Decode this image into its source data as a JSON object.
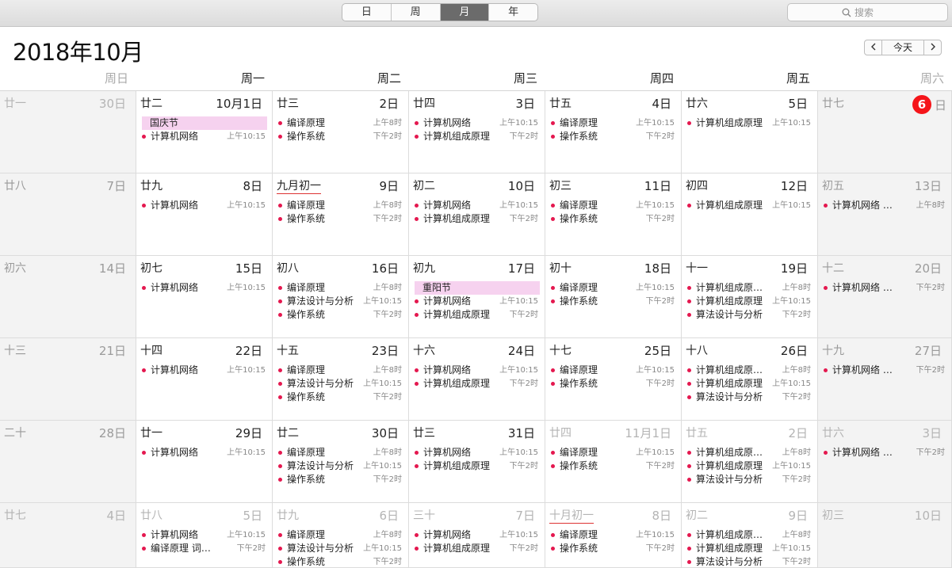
{
  "toolbar": {
    "views": [
      {
        "label": "日"
      },
      {
        "label": "周"
      },
      {
        "label": "月",
        "active": true
      },
      {
        "label": "年"
      }
    ],
    "search_placeholder": "搜索"
  },
  "header": {
    "title": "2018年10月",
    "today_label": "今天"
  },
  "weekdays": [
    "周日",
    "周一",
    "周二",
    "周三",
    "周四",
    "周五",
    "周六"
  ],
  "weeks": [
    [
      {
        "lunar": "廿一",
        "day": "30日",
        "outside": true
      },
      {
        "lunar": "廿二",
        "day": "10月1日",
        "allday": "国庆节",
        "events": [
          {
            "name": "计算机网络",
            "time": "上午10:15"
          }
        ]
      },
      {
        "lunar": "廿三",
        "day": "2日",
        "events": [
          {
            "name": "编译原理",
            "time": "上午8时"
          },
          {
            "name": "操作系统",
            "time": "下午2时"
          }
        ]
      },
      {
        "lunar": "廿四",
        "day": "3日",
        "events": [
          {
            "name": "计算机网络",
            "time": "上午10:15"
          },
          {
            "name": "计算机组成原理",
            "time": "下午2时"
          }
        ]
      },
      {
        "lunar": "廿五",
        "day": "4日",
        "events": [
          {
            "name": "编译原理",
            "time": "上午10:15"
          },
          {
            "name": "操作系统",
            "time": "下午2时"
          }
        ]
      },
      {
        "lunar": "廿六",
        "day": "5日",
        "events": [
          {
            "name": "计算机组成原理",
            "time": "上午10:15"
          }
        ]
      },
      {
        "lunar": "廿七",
        "day": "6",
        "daysuffix": "日",
        "today": true
      }
    ],
    [
      {
        "lunar": "廿八",
        "day": "7日"
      },
      {
        "lunar": "廿九",
        "day": "8日",
        "events": [
          {
            "name": "计算机网络",
            "time": "上午10:15"
          }
        ]
      },
      {
        "lunar": "九月初一",
        "day": "9日",
        "month": true,
        "events": [
          {
            "name": "编译原理",
            "time": "上午8时"
          },
          {
            "name": "操作系统",
            "time": "下午2时"
          }
        ]
      },
      {
        "lunar": "初二",
        "day": "10日",
        "events": [
          {
            "name": "计算机网络",
            "time": "上午10:15"
          },
          {
            "name": "计算机组成原理",
            "time": "下午2时"
          }
        ]
      },
      {
        "lunar": "初三",
        "day": "11日",
        "events": [
          {
            "name": "编译原理",
            "time": "上午10:15"
          },
          {
            "name": "操作系统",
            "time": "下午2时"
          }
        ]
      },
      {
        "lunar": "初四",
        "day": "12日",
        "events": [
          {
            "name": "计算机组成原理",
            "time": "上午10:15"
          }
        ]
      },
      {
        "lunar": "初五",
        "day": "13日",
        "events": [
          {
            "name": "计算机网络 计…",
            "time": "上午8时"
          }
        ]
      }
    ],
    [
      {
        "lunar": "初六",
        "day": "14日"
      },
      {
        "lunar": "初七",
        "day": "15日",
        "events": [
          {
            "name": "计算机网络",
            "time": "上午10:15"
          }
        ]
      },
      {
        "lunar": "初八",
        "day": "16日",
        "events": [
          {
            "name": "编译原理",
            "time": "上午8时"
          },
          {
            "name": "算法设计与分析",
            "time": "上午10:15"
          },
          {
            "name": "操作系统",
            "time": "下午2时"
          }
        ]
      },
      {
        "lunar": "初九",
        "day": "17日",
        "allday": "重阳节",
        "events": [
          {
            "name": "计算机网络",
            "time": "上午10:15"
          },
          {
            "name": "计算机组成原理",
            "time": "下午2时"
          }
        ]
      },
      {
        "lunar": "初十",
        "day": "18日",
        "events": [
          {
            "name": "编译原理",
            "time": "上午10:15"
          },
          {
            "name": "操作系统",
            "time": "下午2时"
          }
        ]
      },
      {
        "lunar": "十一",
        "day": "19日",
        "events": [
          {
            "name": "计算机组成原理…",
            "time": "上午8时"
          },
          {
            "name": "计算机组成原理",
            "time": "上午10:15"
          },
          {
            "name": "算法设计与分析",
            "time": "下午2时"
          }
        ]
      },
      {
        "lunar": "十二",
        "day": "20日",
        "events": [
          {
            "name": "计算机网络 交…",
            "time": "下午2时"
          }
        ]
      }
    ],
    [
      {
        "lunar": "十三",
        "day": "21日"
      },
      {
        "lunar": "十四",
        "day": "22日",
        "events": [
          {
            "name": "计算机网络",
            "time": "上午10:15"
          }
        ]
      },
      {
        "lunar": "十五",
        "day": "23日",
        "events": [
          {
            "name": "编译原理",
            "time": "上午8时"
          },
          {
            "name": "算法设计与分析",
            "time": "上午10:15"
          },
          {
            "name": "操作系统",
            "time": "下午2时"
          }
        ]
      },
      {
        "lunar": "十六",
        "day": "24日",
        "events": [
          {
            "name": "计算机网络",
            "time": "上午10:15"
          },
          {
            "name": "计算机组成原理",
            "time": "下午2时"
          }
        ]
      },
      {
        "lunar": "十七",
        "day": "25日",
        "events": [
          {
            "name": "编译原理",
            "time": "上午10:15"
          },
          {
            "name": "操作系统",
            "time": "下午2时"
          }
        ]
      },
      {
        "lunar": "十八",
        "day": "26日",
        "events": [
          {
            "name": "计算机组成原理…",
            "time": "上午8时"
          },
          {
            "name": "计算机组成原理",
            "time": "上午10:15"
          },
          {
            "name": "算法设计与分析",
            "time": "下午2时"
          }
        ]
      },
      {
        "lunar": "十九",
        "day": "27日",
        "events": [
          {
            "name": "计算机网络 路…",
            "time": "下午2时"
          }
        ]
      }
    ],
    [
      {
        "lunar": "二十",
        "day": "28日"
      },
      {
        "lunar": "廿一",
        "day": "29日",
        "events": [
          {
            "name": "计算机网络",
            "time": "上午10:15"
          }
        ]
      },
      {
        "lunar": "廿二",
        "day": "30日",
        "events": [
          {
            "name": "编译原理",
            "time": "上午8时"
          },
          {
            "name": "算法设计与分析",
            "time": "上午10:15"
          },
          {
            "name": "操作系统",
            "time": "下午2时"
          }
        ]
      },
      {
        "lunar": "廿三",
        "day": "31日",
        "events": [
          {
            "name": "计算机网络",
            "time": "上午10:15"
          },
          {
            "name": "计算机组成原理",
            "time": "下午2时"
          }
        ]
      },
      {
        "lunar": "廿四",
        "day": "11月1日",
        "outside": true,
        "events": [
          {
            "name": "编译原理",
            "time": "上午10:15"
          },
          {
            "name": "操作系统",
            "time": "下午2时"
          }
        ]
      },
      {
        "lunar": "廿五",
        "day": "2日",
        "outside": true,
        "events": [
          {
            "name": "计算机组成原理…",
            "time": "上午8时"
          },
          {
            "name": "计算机组成原理",
            "time": "上午10:15"
          },
          {
            "name": "算法设计与分析",
            "time": "下午2时"
          }
        ]
      },
      {
        "lunar": "廿六",
        "day": "3日",
        "outside": true,
        "events": [
          {
            "name": "计算机网络 路…",
            "time": "下午2时"
          }
        ]
      }
    ],
    [
      {
        "lunar": "廿七",
        "day": "4日",
        "outside": true
      },
      {
        "lunar": "廿八",
        "day": "5日",
        "outside": true,
        "events": [
          {
            "name": "计算机网络",
            "time": "上午10:15"
          },
          {
            "name": "编译原理 词法…",
            "time": "下午2时"
          }
        ]
      },
      {
        "lunar": "廿九",
        "day": "6日",
        "outside": true,
        "events": [
          {
            "name": "编译原理",
            "time": "上午8时"
          },
          {
            "name": "算法设计与分析",
            "time": "上午10:15"
          },
          {
            "name": "操作系统",
            "time": "下午2时"
          }
        ]
      },
      {
        "lunar": "三十",
        "day": "7日",
        "outside": true,
        "events": [
          {
            "name": "计算机网络",
            "time": "上午10:15"
          },
          {
            "name": "计算机组成原理",
            "time": "下午2时"
          }
        ]
      },
      {
        "lunar": "十月初一",
        "day": "8日",
        "outside": true,
        "month": true,
        "events": [
          {
            "name": "编译原理",
            "time": "上午10:15"
          },
          {
            "name": "操作系统",
            "time": "下午2时"
          }
        ]
      },
      {
        "lunar": "初二",
        "day": "9日",
        "outside": true,
        "events": [
          {
            "name": "计算机组成原理…",
            "time": "上午8时"
          },
          {
            "name": "计算机组成原理",
            "time": "上午10:15"
          },
          {
            "name": "算法设计与分析",
            "time": "下午2时"
          }
        ]
      },
      {
        "lunar": "初三",
        "day": "10日",
        "outside": true
      }
    ]
  ]
}
